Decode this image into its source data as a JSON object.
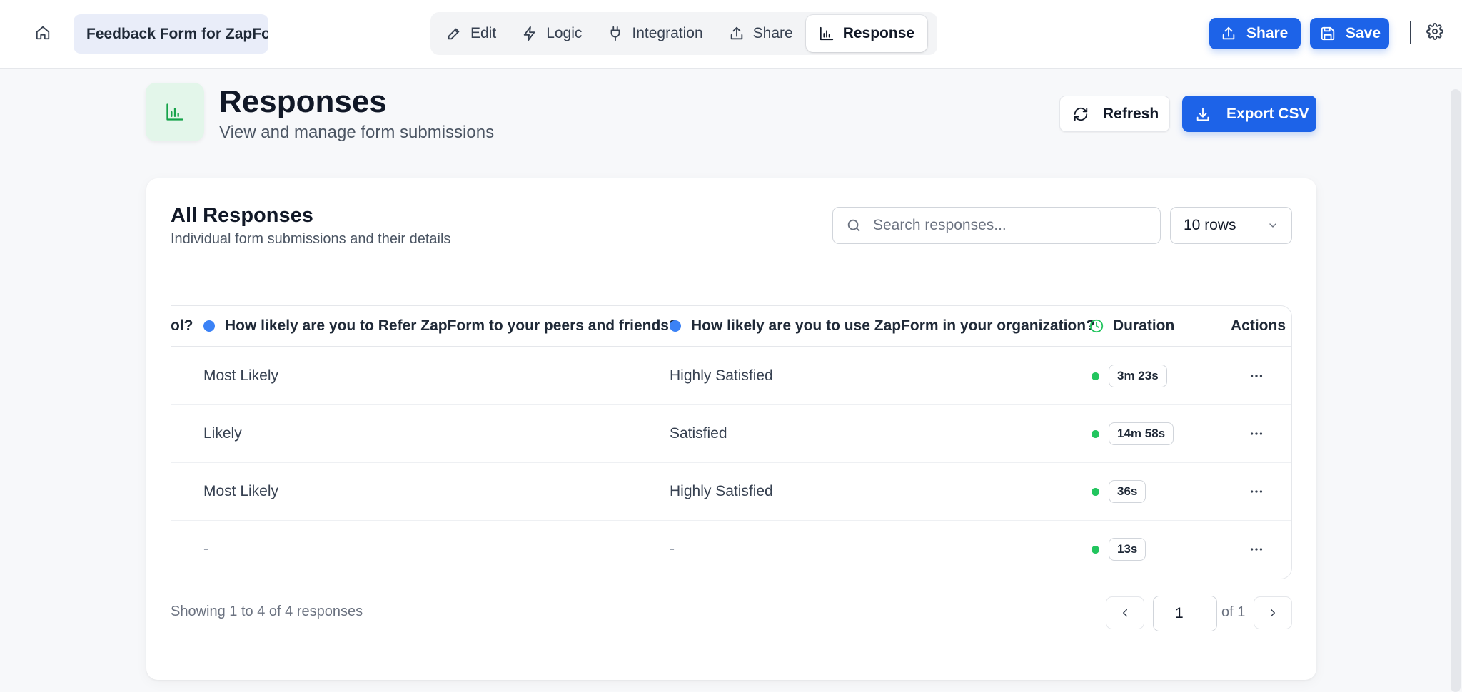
{
  "topbar": {
    "form_title": "Feedback Form for ZapForm",
    "nav": [
      {
        "label": "Edit",
        "icon": "pencil-icon"
      },
      {
        "label": "Logic",
        "icon": "lightning-icon"
      },
      {
        "label": "Integration",
        "icon": "plug-icon"
      },
      {
        "label": "Share",
        "icon": "share-icon"
      },
      {
        "label": "Response",
        "icon": "bar-chart-icon",
        "active": true
      }
    ],
    "share_label": "Share",
    "save_label": "Save"
  },
  "page": {
    "title": "Responses",
    "subtitle": "View and manage form submissions",
    "refresh_label": "Refresh",
    "export_label": "Export CSV"
  },
  "card": {
    "title": "All Responses",
    "subtitle": "Individual form submissions and their details",
    "search_placeholder": "Search responses...",
    "rows_select": "10 rows"
  },
  "table": {
    "headers": {
      "col_prev_truncated": "ol?",
      "col_refer": "How likely are you to Refer ZapForm to your peers and friends?",
      "col_use": "How likely are you to use ZapForm in your organization?",
      "col_duration": "Duration",
      "col_actions": "Actions"
    },
    "rows": [
      {
        "refer": "Most Likely",
        "use": "Highly Satisfied",
        "duration": "3m 23s"
      },
      {
        "refer": "Likely",
        "use": "Satisfied",
        "duration": "14m 58s"
      },
      {
        "refer": "Most Likely",
        "use": "Highly Satisfied",
        "duration": "36s"
      },
      {
        "refer": "-",
        "use": "-",
        "duration": "13s"
      }
    ]
  },
  "footer": {
    "showing": "Showing 1 to 4 of 4 responses",
    "page_value": "1",
    "page_of": "of 1"
  },
  "colors": {
    "primary": "#1d63e8",
    "accent_green": "#16a34a",
    "dot_blue": "#3b82f6",
    "dot_green": "#22c55e"
  }
}
